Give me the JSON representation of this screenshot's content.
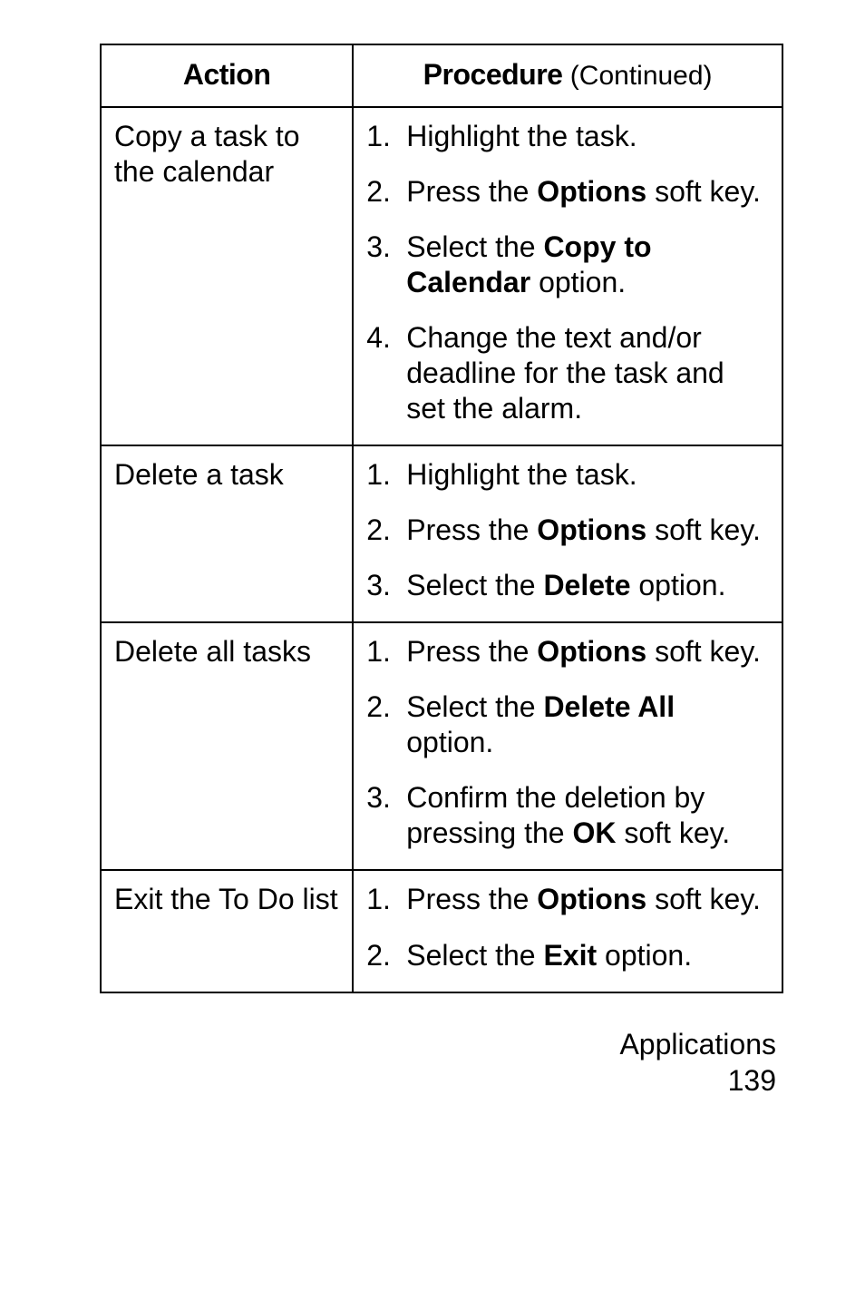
{
  "table": {
    "header": {
      "action": "Action",
      "procedure_bold": "Procedure",
      "procedure_tail": " (Continued)"
    },
    "rows": [
      {
        "action": "Copy a task to the calendar",
        "steps": [
          {
            "pre": "Highlight the task.",
            "bold": "",
            "post": ""
          },
          {
            "pre": "Press the ",
            "bold": "Options",
            "post": " soft key."
          },
          {
            "pre": "Select the ",
            "bold": "Copy to Calendar",
            "post": " option."
          },
          {
            "pre": "Change the text and/or deadline for the task and set the alarm.",
            "bold": "",
            "post": ""
          }
        ]
      },
      {
        "action": "Delete a task",
        "steps": [
          {
            "pre": "Highlight the task.",
            "bold": "",
            "post": ""
          },
          {
            "pre": "Press the ",
            "bold": "Options",
            "post": " soft key."
          },
          {
            "pre": "Select the ",
            "bold": "Delete",
            "post": " option."
          }
        ]
      },
      {
        "action": "Delete all tasks",
        "steps": [
          {
            "pre": "Press the ",
            "bold": "Options",
            "post": " soft key."
          },
          {
            "pre": "Select the ",
            "bold": "Delete All",
            "post": " option."
          },
          {
            "pre": "Confirm the deletion by pressing the ",
            "bold": "OK",
            "post": " soft key."
          }
        ]
      },
      {
        "action": "Exit the To Do list",
        "steps": [
          {
            "pre": "Press the ",
            "bold": "Options",
            "post": " soft key."
          },
          {
            "pre": "Select the ",
            "bold": "Exit",
            "post": " option."
          }
        ]
      }
    ]
  },
  "footer": {
    "section": "Applications",
    "page_number": "139"
  }
}
